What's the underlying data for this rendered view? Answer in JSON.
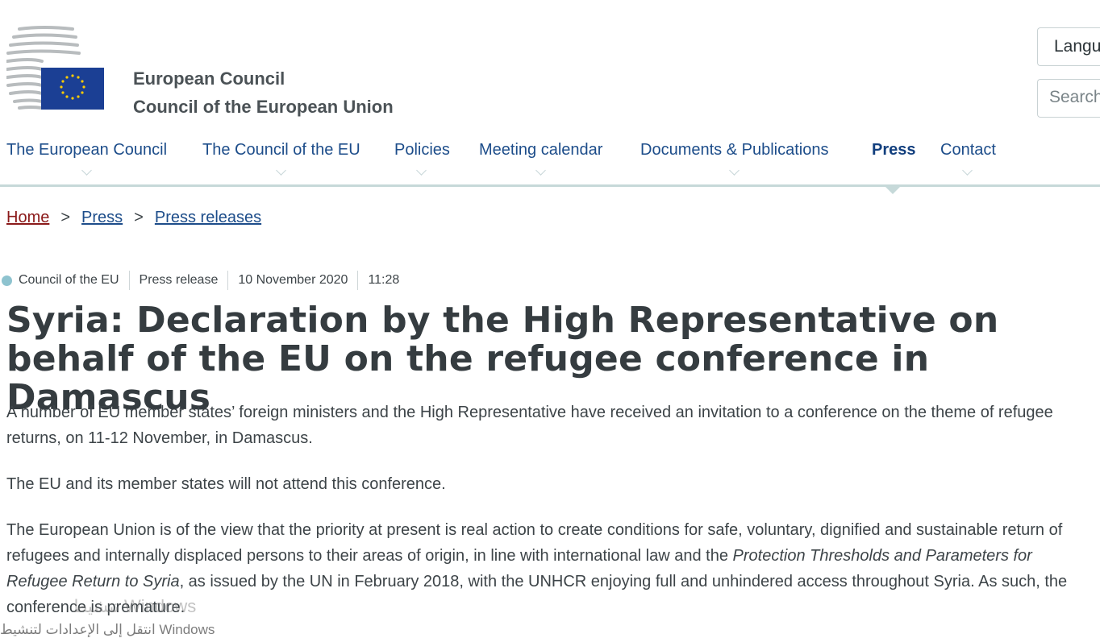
{
  "header": {
    "org_name_1": "European Council",
    "org_name_2": "Council of the European Union",
    "language_label": "Langu",
    "search_placeholder": "Search"
  },
  "nav": {
    "items": [
      {
        "label": "The European Council"
      },
      {
        "label": "The Council of the EU"
      },
      {
        "label": "Policies"
      },
      {
        "label": "Meeting calendar"
      },
      {
        "label": "Documents & Publications"
      },
      {
        "label": "Press"
      },
      {
        "label": "Contact"
      }
    ],
    "active": "Press"
  },
  "breadcrumb": {
    "home": "Home",
    "sep": ">",
    "press": "Press",
    "press_releases": "Press releases"
  },
  "meta": {
    "source": "Council of the EU",
    "type": "Press release",
    "date": "10 November 2020",
    "time": "11:28"
  },
  "article": {
    "title": "Syria: Declaration by the High Representative on behalf of the EU on the refugee conference in Damascus",
    "p1": "A number of EU member states’ foreign ministers and the High Representative have received an invitation to a conference on the theme of refugee returns, on 11-12 November, in Damascus.",
    "p2": "The EU and its member states will not attend this conference.",
    "p3_start": "The European Union is of the view that the priority at present is real action to create conditions for safe, voluntary, dignified and sustainable return of refugees and internally displaced persons to their areas of origin, in line with international law and the ",
    "p3_italic": "Protection Thresholds and Parameters for Refugee Return to Syria",
    "p3_end": ", as issued by the UN in February 2018, with the UNHCR enjoying full and unhindered access throughout Syria. As such, the conference is premature."
  },
  "watermark": {
    "line1": "تنشيط Windows",
    "line2": "انتقل إلى الإعدادات لتنشيط Windows"
  },
  "colors": {
    "nav_link": "#1d4d8a",
    "home_link": "#8b1a1a",
    "eu_blue": "#1b3f94",
    "eu_star": "#ffcc00",
    "accent_line": "#c6d9d9"
  }
}
